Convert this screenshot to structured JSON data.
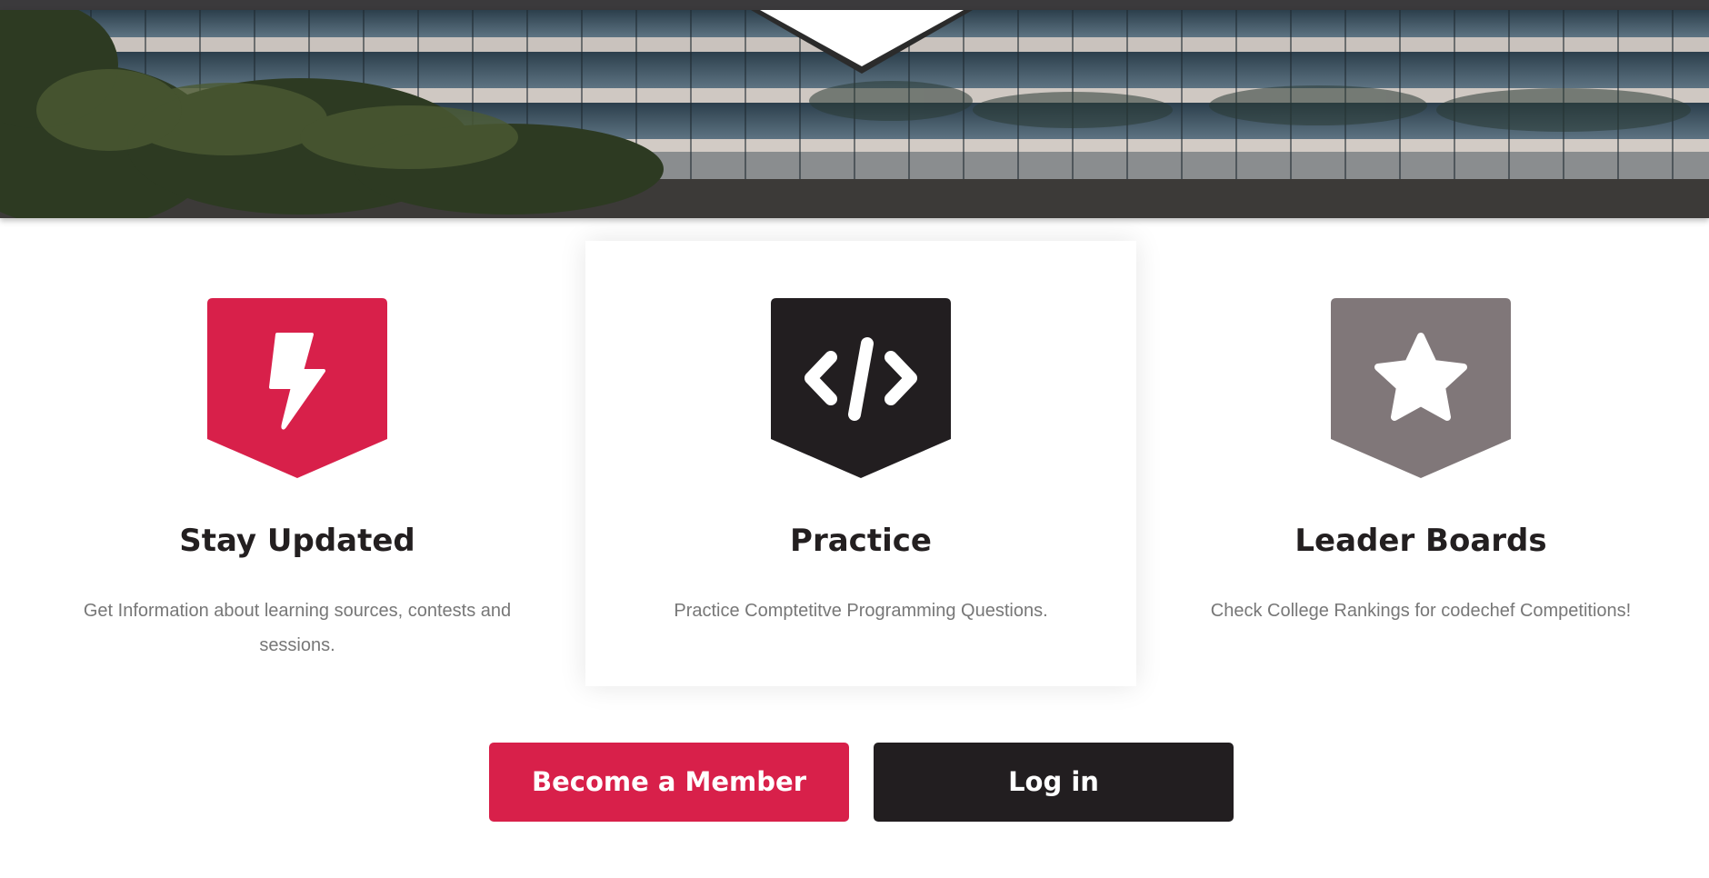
{
  "colors": {
    "accent_red": "#d8204a",
    "dark": "#221e20",
    "gray_badge": "#807779",
    "text_muted": "#777777",
    "heading": "#231f20"
  },
  "hero": {
    "image_description_icon": "building-photo"
  },
  "features": [
    {
      "icon": "lightning-icon",
      "badge_color": "#d8204a",
      "title": "Stay Updated",
      "description": "Get Information about learning sources, contests and sessions."
    },
    {
      "icon": "code-icon",
      "badge_color": "#221e20",
      "title": "Practice",
      "description": "Practice Comptetitve Programming Questions."
    },
    {
      "icon": "star-icon",
      "badge_color": "#807779",
      "title": "Leader Boards",
      "description": "Check College Rankings for codechef Competitions!"
    }
  ],
  "actions": {
    "become_member_label": "Become a Member",
    "login_label": "Log in"
  }
}
